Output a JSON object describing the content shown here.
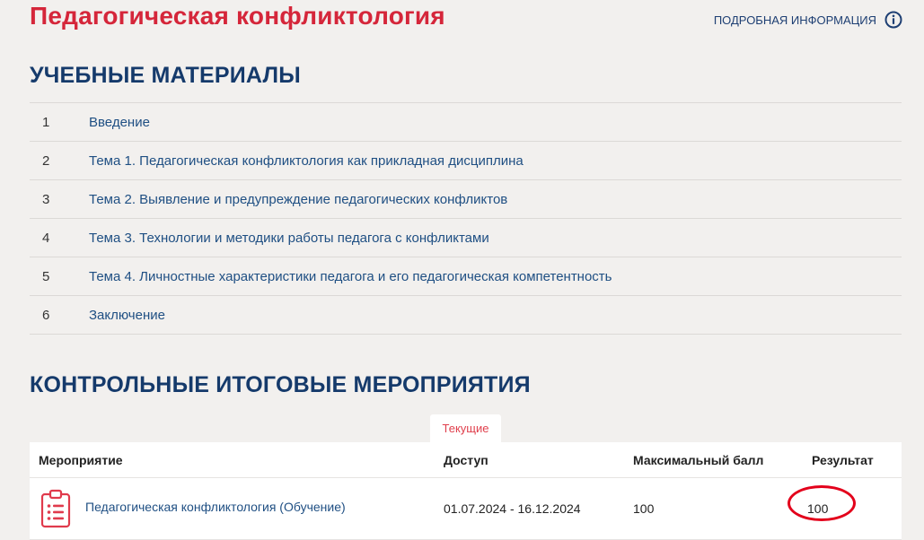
{
  "header": {
    "title": "Педагогическая конфликтология",
    "info_link": "ПОДРОБНАЯ ИНФОРМАЦИЯ",
    "info_icon": "info-circle-icon"
  },
  "materials": {
    "title": "УЧЕБНЫЕ МАТЕРИАЛЫ",
    "items": [
      {
        "num": "1",
        "label": "Введение"
      },
      {
        "num": "2",
        "label": "Тема 1. Педагогическая конфликтология как прикладная дисциплина"
      },
      {
        "num": "3",
        "label": "Тема 2. Выявление и предупреждение педагогических конфликтов"
      },
      {
        "num": "4",
        "label": "Тема 3. Технологии и методики работы педагога с конфликтами"
      },
      {
        "num": "5",
        "label": "Тема 4. Личностные характеристики педагога и его педагогическая компетентность"
      },
      {
        "num": "6",
        "label": "Заключение"
      }
    ]
  },
  "control": {
    "title": "КОНТРОЛЬНЫЕ ИТОГОВЫЕ МЕРОПРИЯТИЯ",
    "tab_current": "Текущие",
    "columns": {
      "event": "Мероприятие",
      "access": "Доступ",
      "max_score": "Максимальный балл",
      "result": "Результат"
    },
    "rows": [
      {
        "icon": "clipboard-list-icon",
        "event": "Педагогическая конфликтология (Обучение)",
        "access": "01.07.2024 - 16.12.2024",
        "max_score": "100",
        "result": "100"
      }
    ]
  },
  "colors": {
    "title_red": "#d5263a",
    "heading_navy": "#153a6b",
    "link_blue": "#1f4f83",
    "tab_red": "#e0404d",
    "highlight_red": "#e3001b",
    "background": "#f2f0ee"
  }
}
